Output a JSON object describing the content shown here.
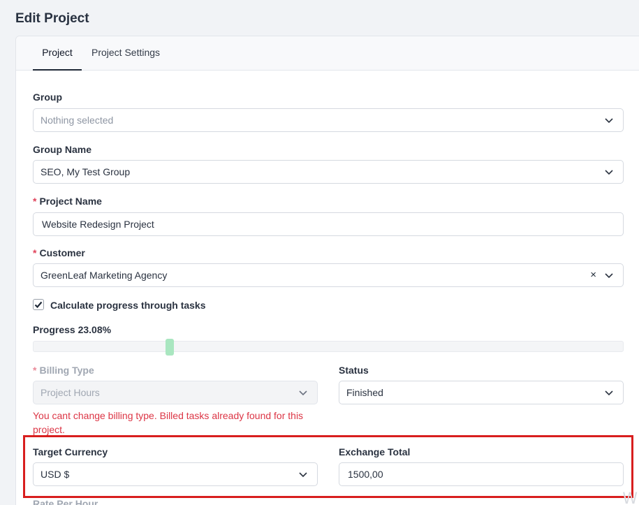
{
  "page": {
    "title": "Edit Project"
  },
  "tabs": [
    {
      "label": "Project",
      "active": true
    },
    {
      "label": "Project Settings",
      "active": false
    }
  ],
  "form": {
    "group": {
      "label": "Group",
      "placeholder": "Nothing selected"
    },
    "group_name": {
      "label": "Group Name",
      "value": "SEO, My Test Group"
    },
    "project_name": {
      "label": "Project Name",
      "required_mark": "*",
      "value": "Website Redesign Project"
    },
    "customer": {
      "label": "Customer",
      "required_mark": "*",
      "value": "GreenLeaf Marketing Agency",
      "clear": "×"
    },
    "calc_progress": {
      "label": "Calculate progress through tasks",
      "checked": true
    },
    "progress": {
      "label": "Progress 23.08%",
      "value_percent": 23.08
    },
    "billing_type": {
      "label": "Billing Type",
      "required_mark": "*",
      "value": "Project Hours",
      "disabled": true,
      "error": "You cant change billing type. Billed tasks already found for this project."
    },
    "status": {
      "label": "Status",
      "value": "Finished"
    },
    "target_currency": {
      "label": "Target Currency",
      "value": "USD $"
    },
    "exchange_total": {
      "label": "Exchange Total",
      "value": "1500,00"
    },
    "rate_per_hour": {
      "label": "Rate Per Hour"
    }
  },
  "colors": {
    "highlight": "#d81e1e",
    "error": "#dc3545",
    "slider_handle": "#a9e6c0",
    "required": "#e0435a"
  },
  "icons": {
    "chevron": "chevron-down-icon",
    "check": "checkmark-icon",
    "clear": "close-icon"
  },
  "watermark": "W"
}
